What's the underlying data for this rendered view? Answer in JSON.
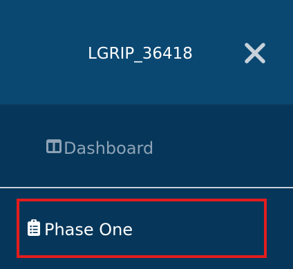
{
  "header": {
    "user_label": "LGRIP_36418",
    "close_icon": "close-icon",
    "background": "#0a4872"
  },
  "nav": {
    "items": [
      {
        "label": "Dashboard",
        "icon": "dashboard-icon",
        "active": false
      },
      {
        "label": "Phase One",
        "icon": "clipboard-list-icon",
        "active": true
      }
    ],
    "background": "#06375a",
    "inactive_text_color": "#8ea3b6",
    "active_text_color": "#ffffff"
  },
  "highlight_color": "#e41c1c"
}
